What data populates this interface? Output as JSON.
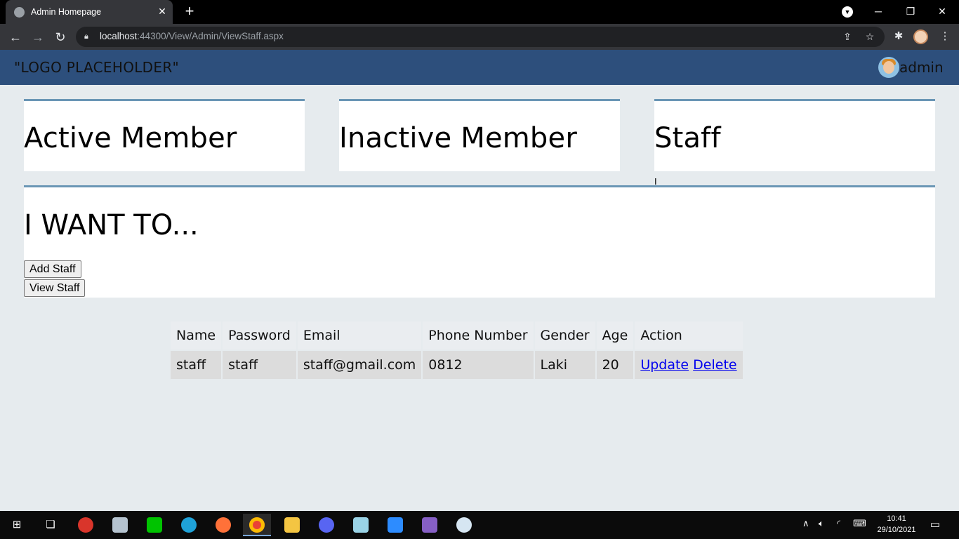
{
  "browser": {
    "tab_title": "Admin Homepage",
    "tab_close": "✕",
    "new_tab": "+",
    "url_host": "localhost",
    "url_rest": ":44300/View/Admin/ViewStaff.aspx",
    "minimize": "─",
    "restore": "❐",
    "close": "✕"
  },
  "header": {
    "logo": "\"LOGO PLACEHOLDER\"",
    "username": "admin"
  },
  "cards": {
    "active": "Active Member",
    "inactive": "Inactive Member",
    "staff": "Staff"
  },
  "panel": {
    "title": "I WANT TO...",
    "add_staff": "Add Staff",
    "view_staff": "View Staff"
  },
  "table": {
    "headers": [
      "Name",
      "Password",
      "Email",
      "Phone Number",
      "Gender",
      "Age",
      "Action"
    ],
    "rows": [
      {
        "name": "staff",
        "password": "staff",
        "email": "staff@gmail.com",
        "phone": "0812",
        "gender": "Laki",
        "age": "20",
        "update": "Update",
        "delete": "Delete"
      }
    ]
  },
  "taskbar": {
    "time": "10:41",
    "date": "29/10/2021"
  }
}
